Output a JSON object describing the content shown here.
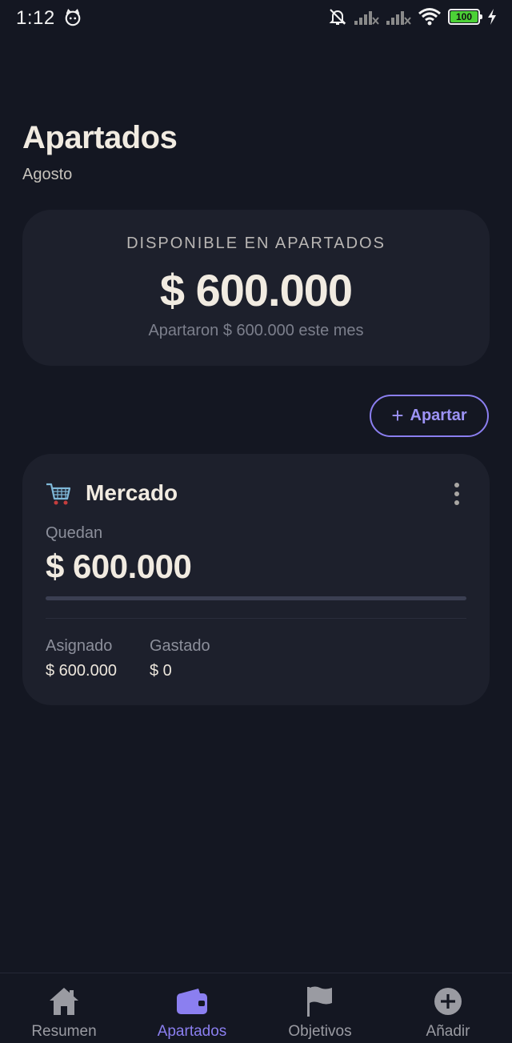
{
  "status_bar": {
    "time": "1:12",
    "battery": "100"
  },
  "header": {
    "title": "Apartados",
    "subtitle": "Agosto"
  },
  "summary": {
    "label": "DISPONIBLE EN APARTADOS",
    "amount": "$ 600.000",
    "note": "Apartaron $ 600.000 este mes"
  },
  "actions": {
    "apartar_label": "Apartar",
    "plus_glyph": "+"
  },
  "envelopes": [
    {
      "name": "Mercado",
      "icon": "shopping-cart-icon",
      "remaining_label": "Quedan",
      "remaining_amount": "$ 600.000",
      "spent_fraction": 0,
      "assigned_label": "Asignado",
      "assigned_value": "$ 600.000",
      "spent_label": "Gastado",
      "spent_value": "$ 0"
    }
  ],
  "bottom_nav": {
    "active": "Apartados",
    "accent_color": "#8b7ff0",
    "items": [
      {
        "label": "Resumen",
        "icon": "home-icon"
      },
      {
        "label": "Apartados",
        "icon": "wallet-icon"
      },
      {
        "label": "Objetivos",
        "icon": "flag-icon"
      },
      {
        "label": "Añadir",
        "icon": "add-circle-icon"
      }
    ]
  }
}
